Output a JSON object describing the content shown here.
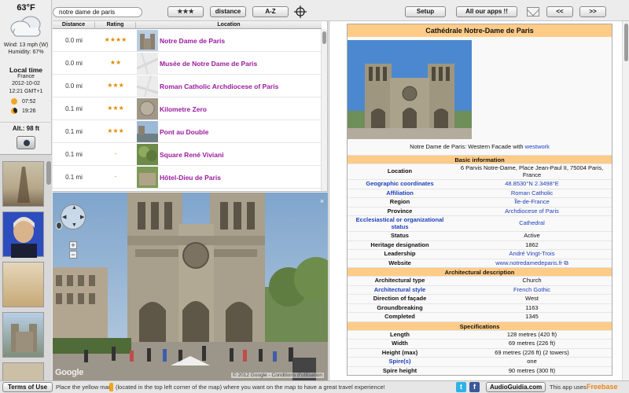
{
  "weather": {
    "temperature": "63°F",
    "wind": "Wind: 13 mph (W)",
    "humidity": "Humidity: 67%"
  },
  "local_time": {
    "title": "Local time",
    "country": "France",
    "date": "2012-10-02",
    "time": "12:21 GMT+1",
    "sunrise": "07:52",
    "sunset": "19:26"
  },
  "altitude": "Alt.: 98 ft",
  "toolbar": {
    "search_value": "notre dame de paris",
    "stars_label": "★★★",
    "distance_label": "distance",
    "az_label": "A-Z",
    "setup_label": "Setup",
    "all_apps_label": "All our apps !!",
    "prev_label": "<<",
    "next_label": ">>"
  },
  "list": {
    "headers": {
      "distance": "Distance",
      "rating": "Rating",
      "location": "Location"
    },
    "rows": [
      {
        "distance": "0.0 mi",
        "rating": "★★★★",
        "name": "Notre Dame de Paris"
      },
      {
        "distance": "0.0 mi",
        "rating": "★★",
        "name": "Musée de Notre Dame de Paris"
      },
      {
        "distance": "0.0 mi",
        "rating": "★★★",
        "name": "Roman Catholic Archdiocese of Paris"
      },
      {
        "distance": "0.1 mi",
        "rating": "★★★",
        "name": "Kilometre Zero"
      },
      {
        "distance": "0.1 mi",
        "rating": "★★★",
        "name": "Pont au Double"
      },
      {
        "distance": "0.1 mi",
        "rating": "-",
        "name": "Square René Viviani"
      },
      {
        "distance": "0.1 mi",
        "rating": "-",
        "name": "Hôtel-Dieu de Paris"
      }
    ]
  },
  "map": {
    "logo": "Google",
    "copyright": "© 2012 Google - Conditions d'utilisation",
    "close_icon": "×",
    "zoom_in": "+",
    "zoom_out": "−"
  },
  "infobox": {
    "title": "Cathédrale Notre-Dame de Paris",
    "caption_prefix": "Notre Dame de Paris: Western Facade with",
    "caption_link": "westwork",
    "sections": [
      {
        "heading": "Basic information",
        "rows": [
          {
            "key": "Location",
            "value": "6 Parvis Notre-Dame, Place Jean-Paul II, 75004 Paris, France",
            "key_link": false,
            "value_link": false
          },
          {
            "key": "Geographic coordinates",
            "value": "48.8530°N 2.3498°E",
            "key_link": true,
            "value_link": true
          },
          {
            "key": "Affiliation",
            "value": "Roman Catholic",
            "key_link": true,
            "value_link": true
          },
          {
            "key": "Region",
            "value": "Île-de-France",
            "key_link": false,
            "value_link": true
          },
          {
            "key": "Province",
            "value": "Archdiocese of Paris",
            "key_link": false,
            "value_link": true
          },
          {
            "key": "Ecclesiastical or organizational status",
            "value": "Cathedral",
            "key_link": true,
            "value_link": true
          },
          {
            "key": "Status",
            "value": "Active",
            "key_link": false,
            "value_link": false
          },
          {
            "key": "Heritage designation",
            "value": "1862",
            "key_link": false,
            "value_link": false
          },
          {
            "key": "Leadership",
            "value": "André Vingt-Trois",
            "key_link": false,
            "value_link": true
          },
          {
            "key": "Website",
            "value": "www.notredamedeparis.fr ⧉",
            "key_link": false,
            "value_link": true
          }
        ]
      },
      {
        "heading": "Architectural description",
        "rows": [
          {
            "key": "Architectural type",
            "value": "Church",
            "key_link": false,
            "value_link": false
          },
          {
            "key": "Architectural style",
            "value": "French Gothic",
            "key_link": true,
            "value_link": true
          },
          {
            "key": "Direction of façade",
            "value": "West",
            "key_link": false,
            "value_link": false
          },
          {
            "key": "Groundbreaking",
            "value": "1163",
            "key_link": false,
            "value_link": false
          },
          {
            "key": "Completed",
            "value": "1345",
            "key_link": false,
            "value_link": false
          }
        ]
      },
      {
        "heading": "Specifications",
        "rows": [
          {
            "key": "Length",
            "value": "128 metres (420 ft)",
            "key_link": false,
            "value_link": false
          },
          {
            "key": "Width",
            "value": "69 metres (226 ft)",
            "key_link": false,
            "value_link": false
          },
          {
            "key": "Height (max)",
            "value": "69 metres (226 ft) (2 towers)",
            "key_link": false,
            "value_link": false
          },
          {
            "key": "Spire(s)",
            "value": "one",
            "key_link": true,
            "value_link": false
          },
          {
            "key": "Spire height",
            "value": "90 metres (300 ft)",
            "key_link": false,
            "value_link": false
          }
        ]
      }
    ]
  },
  "bottombar": {
    "terms_label": "Terms of Use",
    "hint_prefix": "Place the yellow man",
    "hint_suffix": "(located in the top left corner of the map) where you want on the map to have a great travel experience!",
    "audioguidia_label": "AudioGuidia.com",
    "uses_label": "This app uses",
    "freebase_label": "Freebase"
  },
  "colors": {
    "accent_purple": "#9a1a9e",
    "infobox_header": "#ffcc88",
    "link_blue": "#1d3fbb",
    "star_orange": "#e08b00"
  }
}
